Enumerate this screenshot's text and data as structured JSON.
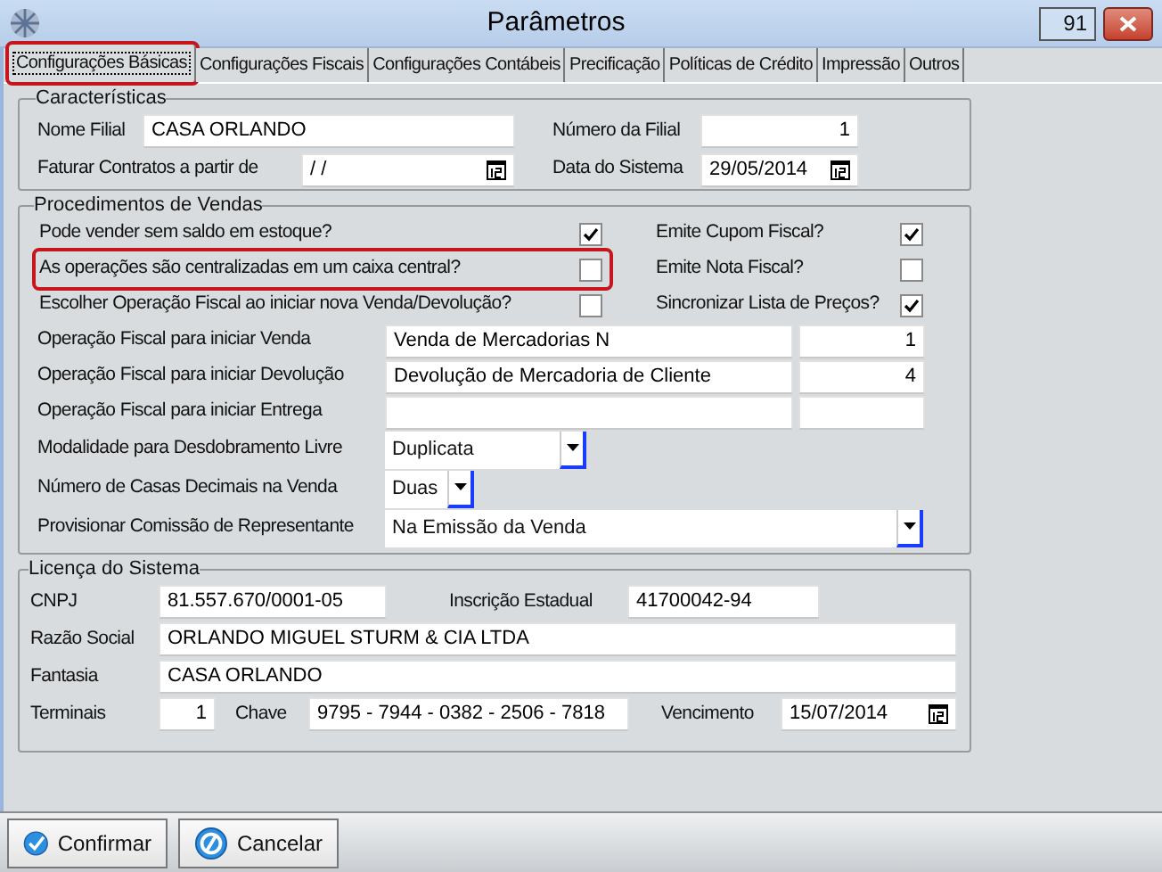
{
  "window": {
    "title": "Parâmetros",
    "counter": "91"
  },
  "tabs": [
    {
      "label": "Configurações Básicas",
      "selected": true,
      "highlighted": true
    },
    {
      "label": "Configurações Fiscais",
      "selected": false,
      "highlighted": false
    },
    {
      "label": "Configurações Contábeis",
      "selected": false,
      "highlighted": false
    },
    {
      "label": "Precificação",
      "selected": false,
      "highlighted": false
    },
    {
      "label": "Políticas de Crédito",
      "selected": false,
      "highlighted": false
    },
    {
      "label": "Impressão",
      "selected": false,
      "highlighted": false
    },
    {
      "label": "Outros",
      "selected": false,
      "highlighted": false
    }
  ],
  "characteristics": {
    "title": "Características",
    "branch_name": {
      "label": "Nome Filial",
      "value": "CASA ORLANDO"
    },
    "branch_number": {
      "label": "Número da Filial",
      "value": "1"
    },
    "contracts_from": {
      "label": "Faturar Contratos a partir de",
      "value": " /  /"
    },
    "system_date": {
      "label": "Data do Sistema",
      "value": "29/05/2014"
    }
  },
  "sales": {
    "title": "Procedimentos de Vendas",
    "check_rows": [
      {
        "left": {
          "label": "Pode vender sem saldo em estoque?",
          "checked": true,
          "highlighted": false
        },
        "right": {
          "label": "Emite Cupom Fiscal?",
          "checked": true
        }
      },
      {
        "left": {
          "label": "As operações são centralizadas em um caixa central?",
          "checked": false,
          "highlighted": true
        },
        "right": {
          "label": "Emite Nota Fiscal?",
          "checked": false
        }
      },
      {
        "left": {
          "label": "Escolher Operação Fiscal ao iniciar nova Venda/Devolução?",
          "checked": false,
          "highlighted": false
        },
        "right": {
          "label": "Sincronizar Lista de Preços?",
          "checked": true
        }
      }
    ],
    "operations": [
      {
        "label": "Operação Fiscal para iniciar Venda",
        "value": "Venda de Mercadorias N",
        "code": "1"
      },
      {
        "label": "Operação Fiscal para iniciar Devolução",
        "value": "Devolução de Mercadoria de Cliente",
        "code": "4"
      },
      {
        "label": "Operação Fiscal para iniciar Entrega"
      }
    ],
    "combos": [
      {
        "label": "Modalidade para Desdobramento Livre",
        "value": "Duplicata",
        "kind": "medium"
      },
      {
        "label": "Número de Casas Decimais na Venda",
        "value": "Duas",
        "kind": "short"
      },
      {
        "label": "Provisionar Comissão de Representante",
        "value": "Na Emissão da Venda",
        "kind": "long"
      }
    ]
  },
  "license": {
    "title": "Licença do Sistema",
    "cnpj": {
      "label": "CNPJ",
      "value": "81.557.670/0001-05"
    },
    "state_registration": {
      "label": "Inscrição Estadual",
      "value": "41700042-94"
    },
    "company_name": {
      "label": "Razão Social",
      "value": "ORLANDO MIGUEL STURM & CIA LTDA"
    },
    "trade_name": {
      "label": "Fantasia",
      "value": "CASA ORLANDO"
    },
    "terminals": {
      "label": "Terminais",
      "value": "1"
    },
    "key": {
      "label": "Chave",
      "value": "9795 - 7944 - 0382 - 2506 - 7818"
    },
    "expiry": {
      "label": "Vencimento",
      "value": "15/07/2014"
    }
  },
  "buttons": [
    {
      "label": "Confirmar",
      "kind": "confirm"
    },
    {
      "label": "Cancelar",
      "kind": "cancel"
    }
  ]
}
